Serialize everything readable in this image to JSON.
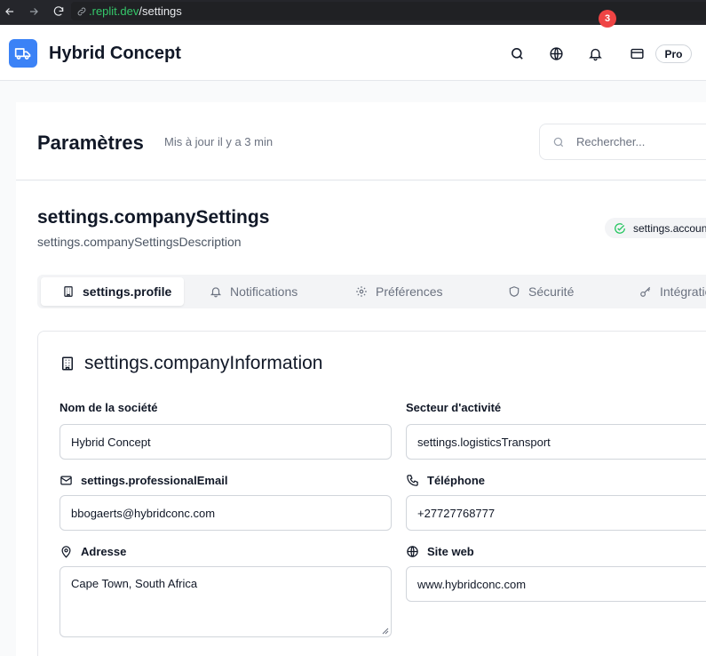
{
  "browser": {
    "url_host": ".replit.dev",
    "url_path": "/settings"
  },
  "header": {
    "app_title": "Hybrid Concept",
    "notification_count": "3",
    "plan_label": "Pro",
    "brand_color": "#3b82f6",
    "icons": [
      "search-icon",
      "globe-icon",
      "bell-icon",
      "credit-card-icon"
    ]
  },
  "page": {
    "title": "Paramètres",
    "subtitle": "Mis à jour il y a 3 min",
    "search_placeholder": "Rechercher..."
  },
  "section": {
    "title": "settings.companySettings",
    "description": "settings.companySettingsDescription",
    "status_label": "settings.accountActive"
  },
  "tabs": [
    {
      "label": "settings.profile",
      "icon": "building-icon",
      "active": true
    },
    {
      "label": "Notifications",
      "icon": "bell-icon",
      "active": false
    },
    {
      "label": "Préférences",
      "icon": "gear-icon",
      "active": false
    },
    {
      "label": "Sécurité",
      "icon": "shield-icon",
      "active": false
    },
    {
      "label": "Intégrations",
      "icon": "key-icon",
      "active": false
    }
  ],
  "card": {
    "title": "settings.companyInformation",
    "fields": {
      "company_name": {
        "label": "Nom de la société",
        "value": "Hybrid Concept"
      },
      "industry": {
        "label": "Secteur d'activité",
        "value": "settings.logisticsTransport"
      },
      "email": {
        "label": "settings.professionalEmail",
        "value": "bbogaerts@hybridconc.com"
      },
      "phone": {
        "label": "Téléphone",
        "value": "+27727768777"
      },
      "address": {
        "label": "Adresse",
        "value": "Cape Town, South Africa"
      },
      "website": {
        "label": "Site web",
        "value": "www.hybridconc.com"
      }
    }
  }
}
